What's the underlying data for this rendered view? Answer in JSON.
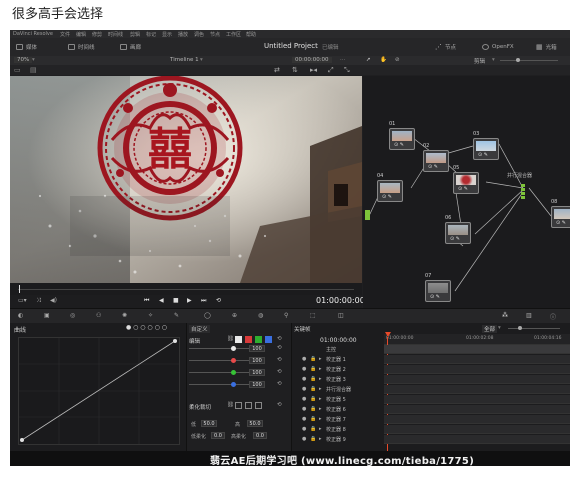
{
  "caption": "很多高手会选择",
  "menu": [
    "DaVinci Resolve",
    "文件",
    "编辑",
    "修剪",
    "时间线",
    "剪辑",
    "标记",
    "显示",
    "播放",
    "调色",
    "节点",
    "工作区",
    "帮助"
  ],
  "topbar": {
    "media_label": "媒体",
    "timeline_label": "时间线",
    "gallery_label": "画廊",
    "project_title": "Untitled Project",
    "project_status": "已编辑",
    "nodes_label": "节点",
    "openfx_label": "OpenFX",
    "lightbox_label": "光箱"
  },
  "secbar": {
    "zoom": "70%",
    "timeline_name": "Timeline 1",
    "timecode": "00:00:00:00",
    "clip_label": "剪辑"
  },
  "viewer": {
    "seal_char": "囍",
    "timecode": "01:00:00:00"
  },
  "nodes": [
    {
      "id": "n01",
      "label": "01",
      "thumb": "sky",
      "icons": "⊙ ✎"
    },
    {
      "id": "n02",
      "label": "02",
      "thumb": "sky",
      "icons": "⊙ ✎"
    },
    {
      "id": "n03",
      "label": "03",
      "thumb": "sky",
      "icons": "⊙ ✎"
    },
    {
      "id": "n04",
      "label": "04",
      "thumb": "sky",
      "icons": "⊙ ✎"
    },
    {
      "id": "n05",
      "label": "05",
      "thumb": "red",
      "icons": "⊙ ✎"
    },
    {
      "id": "n06",
      "label": "06",
      "thumb": "sky",
      "icons": "⊙ ✎"
    },
    {
      "id": "n07",
      "label": "07",
      "thumb": "gray",
      "icons": "⊙ ✎"
    },
    {
      "id": "n08",
      "label": "08",
      "thumb": "sky",
      "icons": "⊙ ✎"
    }
  ],
  "mixer_label": "并行混合器",
  "pagebar": {
    "curves_label": "曲线",
    "custom_label": "自定义",
    "keyframes_label": "关键帧",
    "all_label": "全部"
  },
  "edit_panel": {
    "title": "编辑",
    "channels": [
      {
        "color": "#e8e8e8",
        "value": "100"
      },
      {
        "color": "#e84a4a",
        "value": "100"
      },
      {
        "color": "#36c236",
        "value": "100"
      },
      {
        "color": "#3a6fe0",
        "value": "100"
      }
    ],
    "soft_clip_label": "柔化裁切",
    "low_label": "低",
    "low_value": "50.0",
    "high_label": "高",
    "high_value": "50.0",
    "low_soft_label": "低柔化",
    "low_soft_value": "0.0",
    "high_soft_label": "高柔化",
    "high_soft_value": "0.0"
  },
  "keyframes": {
    "timecode": "01:00:00:00",
    "ruler": [
      "01:00:00:00",
      "01:00:02:08",
      "01:00:04:16"
    ],
    "tracks": [
      "主控",
      "校正器 1",
      "校正器 2",
      "校正器 3",
      "并行混合器",
      "校正器 5",
      "校正器 6",
      "校正器 7",
      "校正器 8",
      "校正器 9"
    ]
  },
  "watermark": "翡云AE后期学习吧 (www.linecg.com/tieba/1775)"
}
